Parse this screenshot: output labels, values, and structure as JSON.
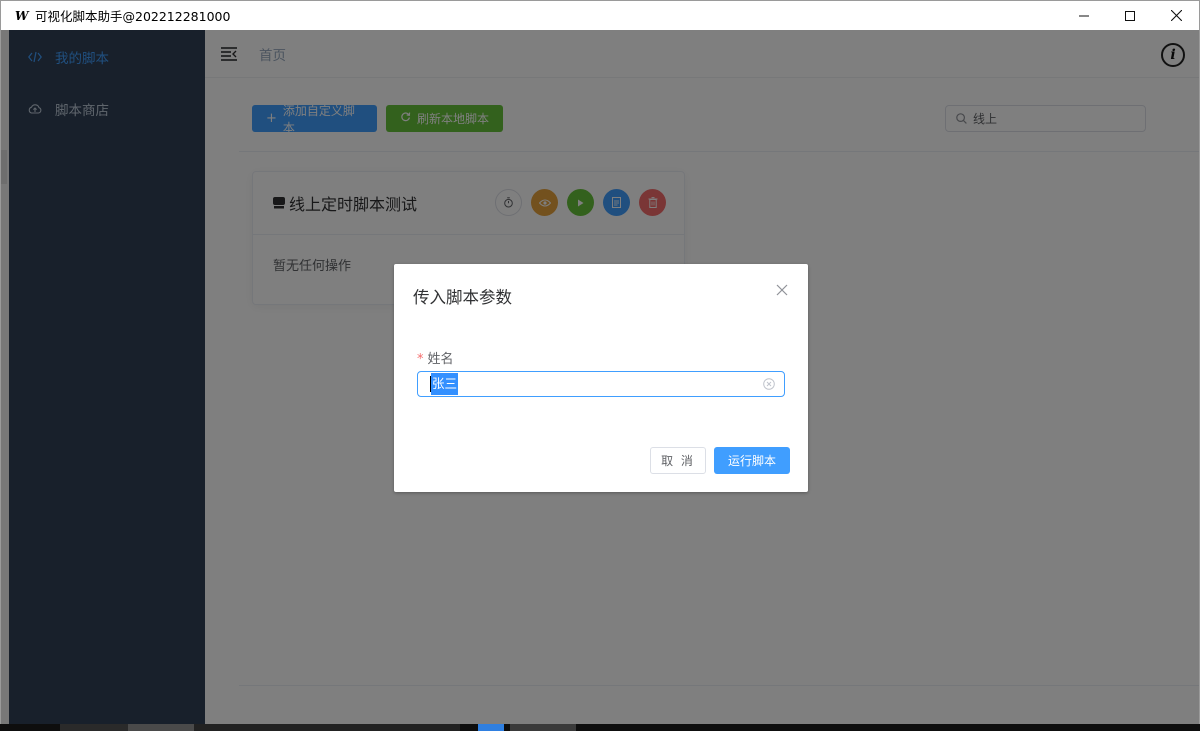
{
  "window": {
    "logo": "W",
    "title": "可视化脚本助手@202212281000",
    "minimize_icon": "minimize-icon",
    "maximize_icon": "maximize-icon",
    "close_icon": "close-icon"
  },
  "sidebar": {
    "items": [
      {
        "label": "我的脚本",
        "icon": "code-icon",
        "active": true
      },
      {
        "label": "脚本商店",
        "icon": "cloud-icon",
        "active": false
      }
    ]
  },
  "navbar": {
    "breadcrumb": "首页",
    "info_icon": "i"
  },
  "toolbar": {
    "add_label": "添加自定义脚本",
    "refresh_label": "刷新本地脚本",
    "search_value": "线上"
  },
  "card": {
    "title": "线上定时脚本测试",
    "body": "暂无任何操作",
    "actions": [
      "timer-icon",
      "eye-icon",
      "play-icon",
      "document-icon",
      "trash-icon"
    ]
  },
  "dialog": {
    "title": "传入脚本参数",
    "required_mark": "*",
    "field_label": "姓名",
    "field_value": "张三",
    "cancel_label": "取 消",
    "run_label": "运行脚本"
  },
  "colors": {
    "primary": "#409eff",
    "success": "#67c23a",
    "warning": "#e6a23c",
    "danger": "#f56c6c",
    "sidebar_bg": "#304156"
  }
}
